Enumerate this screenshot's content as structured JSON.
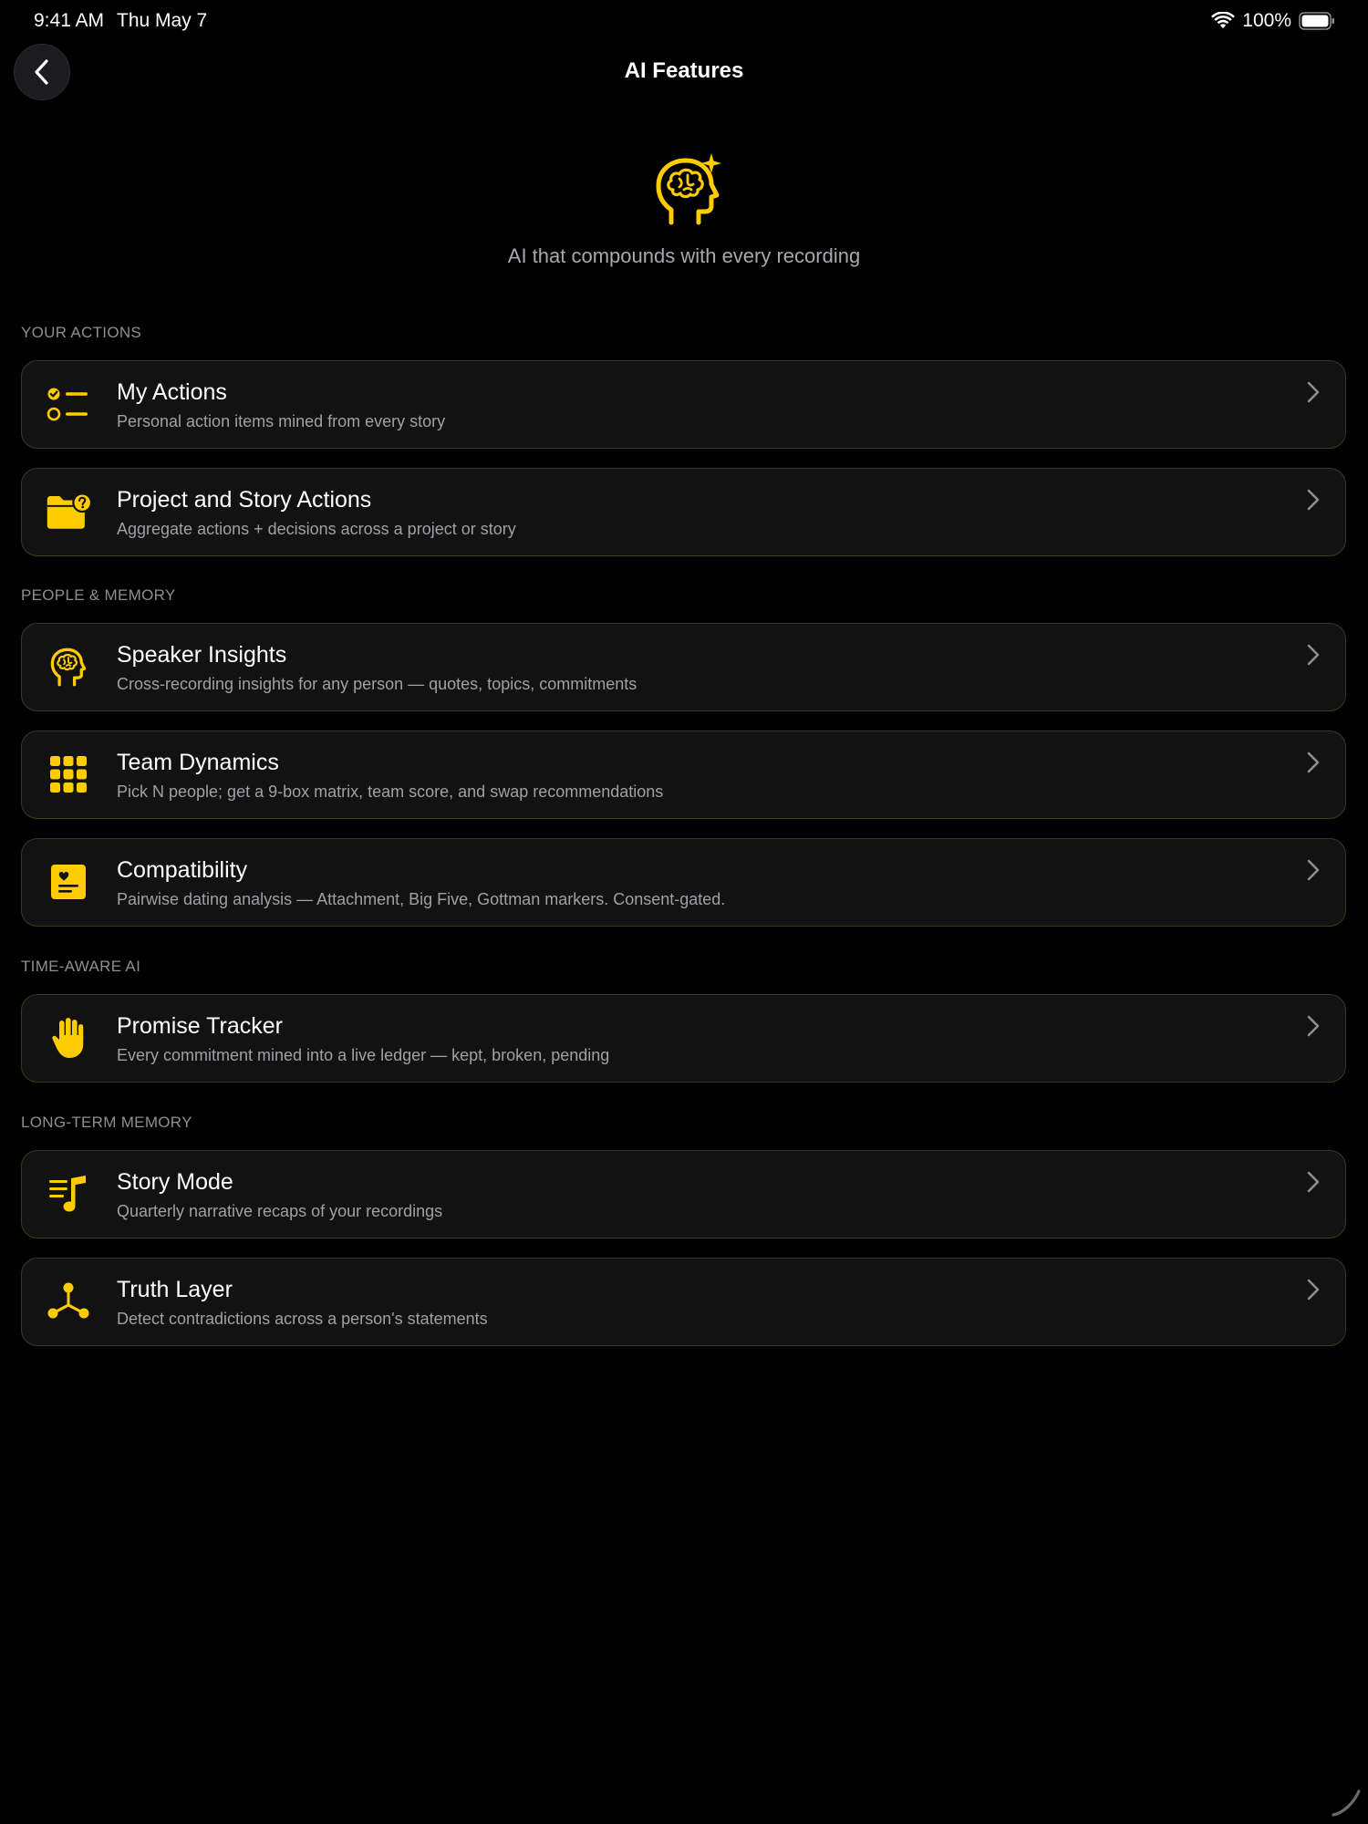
{
  "status_bar": {
    "time": "9:41 AM",
    "date": "Thu May 7",
    "battery": "100%"
  },
  "nav": {
    "title": "AI Features"
  },
  "hero": {
    "tagline": "AI that compounds with every recording"
  },
  "colors": {
    "accent": "#FFCC00",
    "background": "#000000",
    "card": "#121212",
    "card_border": "#3C3A16",
    "secondary_text": "#A0A0A5",
    "section_text": "#8E8E93"
  },
  "sections": [
    {
      "header": "YOUR ACTIONS",
      "items": [
        {
          "icon": "checklist-icon",
          "title": "My Actions",
          "subtitle": "Personal action items mined from every story"
        },
        {
          "icon": "folder-question-icon",
          "title": "Project and Story Actions",
          "subtitle": "Aggregate actions + decisions across a project or story"
        }
      ]
    },
    {
      "header": "PEOPLE & MEMORY",
      "items": [
        {
          "icon": "brain-head-icon",
          "title": "Speaker Insights",
          "subtitle": "Cross-recording insights for any person — quotes, topics, commitments"
        },
        {
          "icon": "grid-nine-icon",
          "title": "Team Dynamics",
          "subtitle": "Pick N people; get a 9-box matrix, team score, and swap recommendations"
        },
        {
          "icon": "heart-card-icon",
          "title": "Compatibility",
          "subtitle": "Pairwise dating analysis — Attachment, Big Five, Gottman markers. Consent-gated."
        }
      ]
    },
    {
      "header": "TIME-AWARE AI",
      "items": [
        {
          "icon": "raised-hand-icon",
          "title": "Promise Tracker",
          "subtitle": "Every commitment mined into a live ledger — kept, broken, pending"
        }
      ]
    },
    {
      "header": "LONG-TERM MEMORY",
      "items": [
        {
          "icon": "music-list-icon",
          "title": "Story Mode",
          "subtitle": "Quarterly narrative recaps of your recordings"
        },
        {
          "icon": "network-nodes-icon",
          "title": "Truth Layer",
          "subtitle": "Detect contradictions across a person's statements"
        }
      ]
    }
  ]
}
